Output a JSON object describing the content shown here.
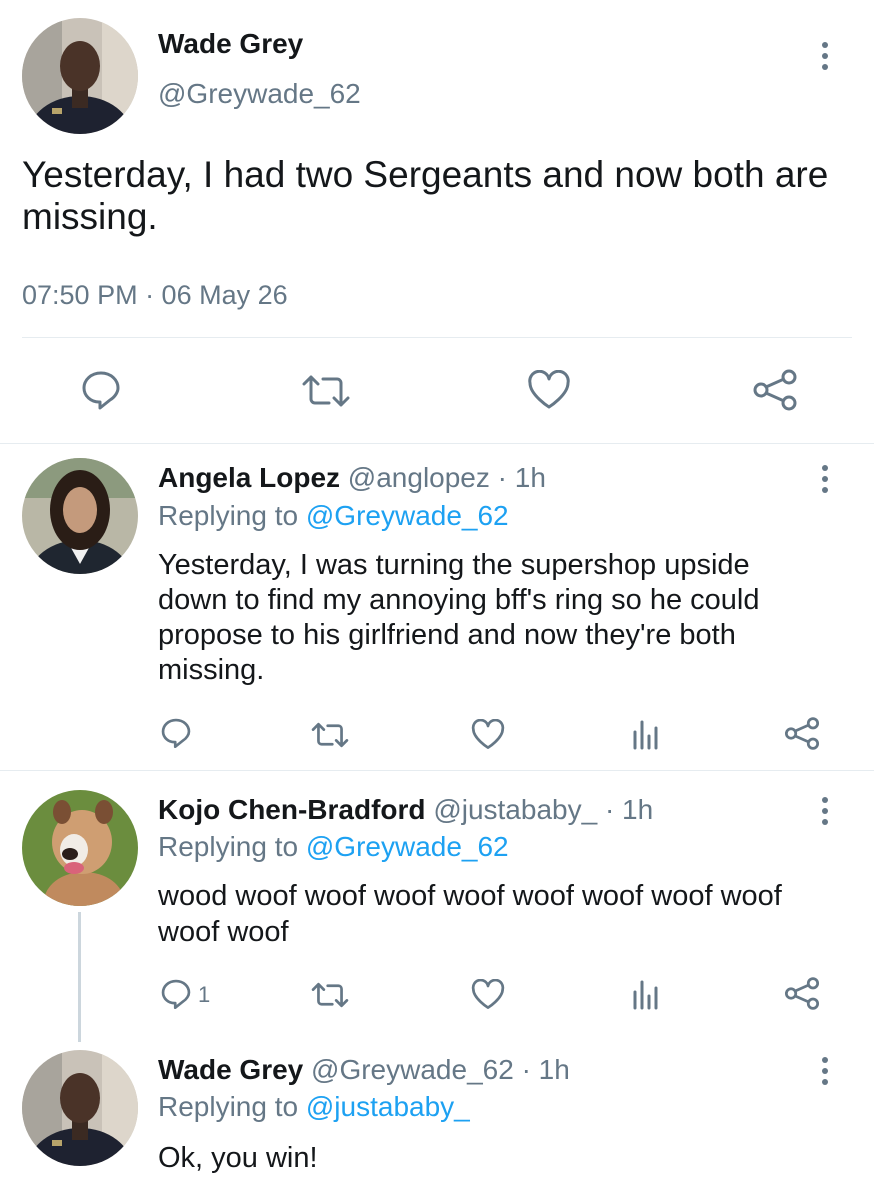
{
  "main_tweet": {
    "author_name": "Wade Grey",
    "handle": "@Greywade_62",
    "text": "Yesterday, I had two Sergeants and now both are missing.",
    "timestamp": "07:50 PM · 06 May 26",
    "actions": [
      "reply-icon",
      "retweet-icon",
      "like-icon",
      "share-icon"
    ]
  },
  "replies": [
    {
      "author_name": "Angela Lopez",
      "handle": "@anglopez",
      "time": "· 1h",
      "replying_label": "Replying to",
      "replying_to": "@Greywade_62",
      "text": "Yesterday, I was turning the supershop upside down to find my annoying bff's ring so he could propose to his girlfriend and now they're both missing.",
      "reply_count": "",
      "actions": [
        "reply-icon",
        "retweet-icon",
        "like-icon",
        "analytics-icon",
        "share-icon"
      ]
    },
    {
      "author_name": "Kojo Chen-Bradford",
      "handle": "@justababy_",
      "time": "· 1h",
      "replying_label": "Replying to",
      "replying_to": "@Greywade_62",
      "text": "wood woof woof woof woof woof woof woof woof woof woof",
      "reply_count": "1",
      "actions": [
        "reply-icon",
        "retweet-icon",
        "like-icon",
        "analytics-icon",
        "share-icon"
      ]
    },
    {
      "author_name": "Wade Grey",
      "handle": "@Greywade_62",
      "time": "· 1h",
      "replying_label": "Replying to",
      "replying_to": "@justababy_",
      "text": "Ok, you win!"
    }
  ],
  "colors": {
    "text": "#14171a",
    "secondary": "#657786",
    "link": "#1da1f2",
    "divider": "#e6ecf0"
  }
}
